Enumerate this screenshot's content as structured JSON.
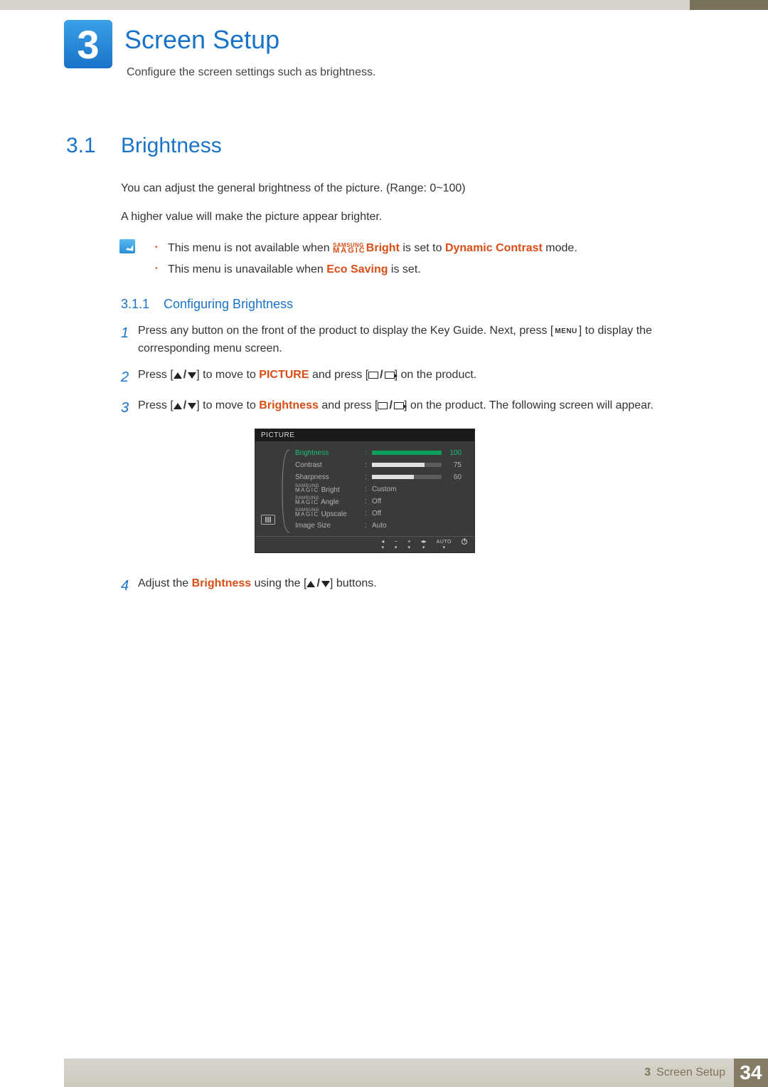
{
  "chapter": {
    "number": "3",
    "title": "Screen Setup",
    "subtitle": "Configure the screen settings such as brightness."
  },
  "section": {
    "number": "3.1",
    "title": "Brightness"
  },
  "paragraphs": {
    "p1": "You can adjust the general brightness of the picture. (Range: 0~100)",
    "p2": "A higher value will make the picture appear brighter."
  },
  "notes": {
    "n1a": "This menu is not available when ",
    "n1_magic_sam": "SAMSUNG",
    "n1_magic_mag": "MAGIC",
    "n1_bright": "Bright",
    "n1b": " is set to ",
    "n1_mode": "Dynamic Contrast",
    "n1c": " mode.",
    "n2a": "This menu is unavailable when ",
    "n2_hl": "Eco Saving",
    "n2b": " is set."
  },
  "subsection": {
    "number": "3.1.1",
    "title": "Configuring Brightness"
  },
  "steps": {
    "s1n": "1",
    "s1a": "Press any button on the front of the product to display the Key Guide. Next, press [",
    "s1_menu": "MENU",
    "s1b": "] to display the corresponding menu screen.",
    "s2n": "2",
    "s2a": "Press [",
    "s2b": "] to move to ",
    "s2_hl": "PICTURE",
    "s2c": " and press [",
    "s2d": "] on the product.",
    "s3n": "3",
    "s3a": "Press [",
    "s3b": "] to move to ",
    "s3_hl": "Brightness",
    "s3c": " and press [",
    "s3d": "] on the product. The following screen will appear.",
    "s4n": "4",
    "s4a": "Adjust the ",
    "s4_hl": "Brightness",
    "s4b": " using the [",
    "s4c": "] buttons."
  },
  "osd": {
    "header": "PICTURE",
    "rows": [
      {
        "label": "Brightness",
        "value": "100",
        "type": "bar",
        "fill": 100,
        "selected": true
      },
      {
        "label": "Contrast",
        "value": "75",
        "type": "bar",
        "fill": 75,
        "selected": false
      },
      {
        "label": "Sharpness",
        "value": "60",
        "type": "bar",
        "fill": 60,
        "selected": false
      },
      {
        "label": "MAGIC Bright",
        "value": "Custom",
        "type": "text",
        "magic": true
      },
      {
        "label": "MAGIC Angle",
        "value": "Off",
        "type": "text",
        "magic": true
      },
      {
        "label": "MAGIC Upscale",
        "value": "Off",
        "type": "text",
        "magic": true
      },
      {
        "label": "Image Size",
        "value": "Auto",
        "type": "text"
      }
    ],
    "footer_auto": "AUTO",
    "magic_sam": "SAMSUNG",
    "magic_mag": "MAGIC"
  },
  "footer": {
    "breadcrumb_num": "3",
    "breadcrumb_txt": "Screen Setup",
    "page": "34"
  }
}
